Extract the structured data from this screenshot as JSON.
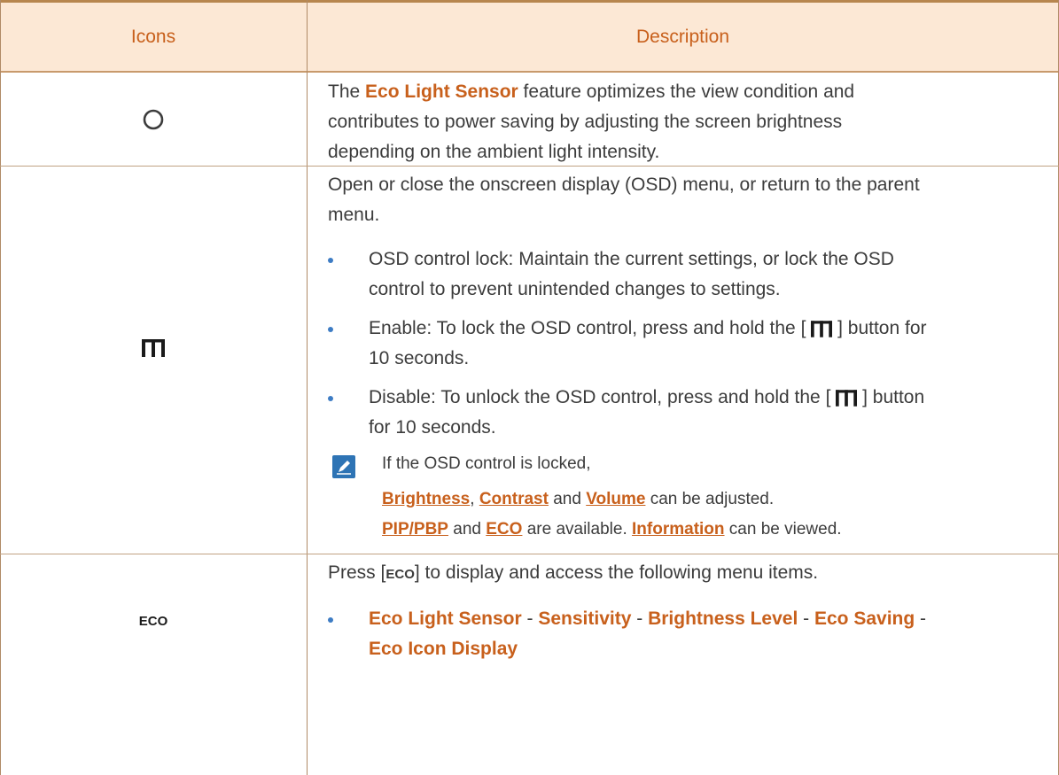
{
  "header": {
    "col_icons": "Icons",
    "col_description": "Description"
  },
  "row1": {
    "icon": "circle-icon",
    "text_a": "The ",
    "highlight": "Eco Light Sensor",
    "text_b": " feature optimizes the view condition and",
    "line2": "contributes to power saving by adjusting the screen brightness",
    "line3": "depending on the ambient light intensity."
  },
  "row2": {
    "icon": "menu-bars-icon",
    "intro_1": "Open or close the onscreen display (OSD) menu, or return to the parent",
    "intro_2": "menu.",
    "b1_l1": "OSD control lock: Maintain the current settings, or lock the OSD",
    "b1_l2": "control to prevent unintended changes to settings.",
    "b2_pre": "Enable: To lock the OSD control, press and hold the [",
    "b2_post": "] button for",
    "b2_l2": "10 seconds.",
    "b3_pre": "Disable: To unlock the OSD control, press and hold the [",
    "b3_post": "] button",
    "b3_l2": "for 10 seconds.",
    "note_l1": "If the OSD control is locked,",
    "note_brightness": "Brightness",
    "note_comma": ", ",
    "note_contrast": "Contrast",
    "note_and1": " and ",
    "note_volume": "Volume",
    "note_tail1": " can be adjusted.",
    "note_pip": "PIP/PBP",
    "note_and2": " and ",
    "note_eco": "ECO",
    "note_avail": " are available. ",
    "note_info": "Information",
    "note_tail2": " can be viewed."
  },
  "row3": {
    "icon_label": "ECO",
    "press_pre": "Press [",
    "press_eco": "ECO",
    "press_post": "] to display and access the following menu items.",
    "m1": "Eco Light Sensor",
    "sep1": " - ",
    "m2": "Sensitivity",
    "sep2": " - ",
    "m3": "Brightness Level",
    "sep3": " - ",
    "m4": "Eco Saving",
    "sep4": " -",
    "m5": "Eco Icon Display"
  },
  "colors": {
    "accent": "#c8601c",
    "header_bg": "#fce8d5",
    "bullet": "#3d7cc4",
    "note_icon": "#2e74b5"
  }
}
